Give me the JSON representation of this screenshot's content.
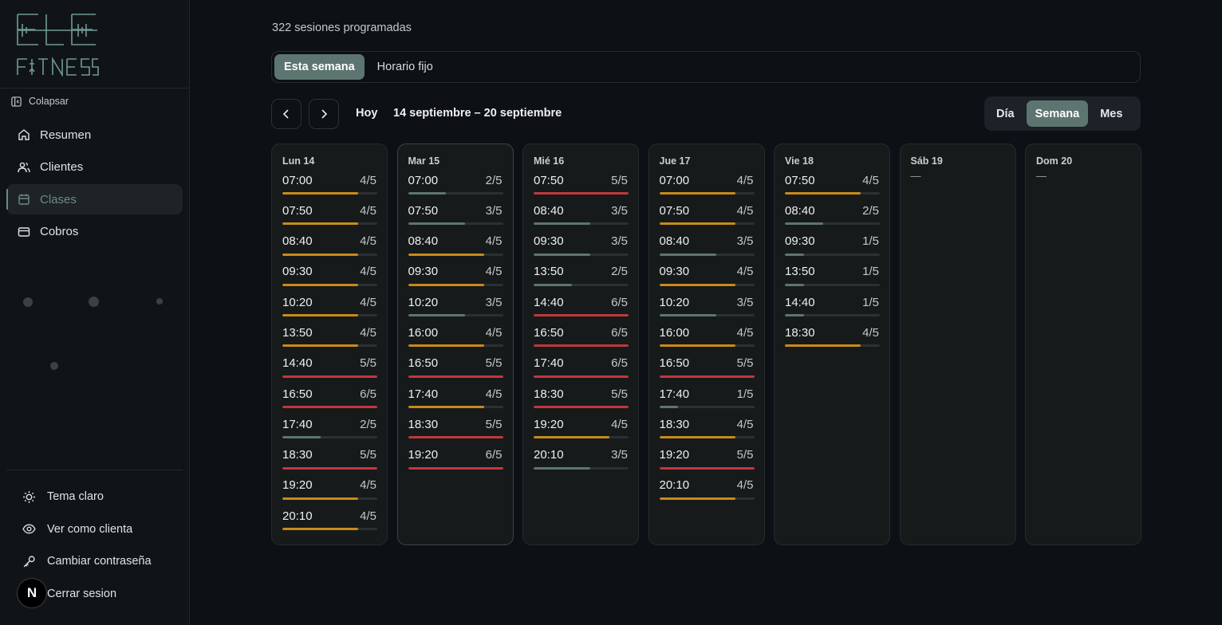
{
  "colors": {
    "orange": "#c98a1b",
    "red": "#c0383d",
    "teal": "#5d7570",
    "track": "#2b3034"
  },
  "sidebar": {
    "brand": "ELE FITNESS",
    "collapse_label": "Colapsar",
    "nav": [
      {
        "label": "Resumen",
        "icon": "home-icon"
      },
      {
        "label": "Clientes",
        "icon": "users-icon"
      },
      {
        "label": "Clases",
        "icon": "calendar-icon",
        "active": true
      },
      {
        "label": "Cobros",
        "icon": "credit-card-icon"
      }
    ],
    "bottom": [
      {
        "label": "Tema claro",
        "icon": "sun-icon"
      },
      {
        "label": "Ver como clienta",
        "icon": "eye-icon"
      },
      {
        "label": "Cambiar contraseña",
        "icon": "key-icon"
      },
      {
        "label": "Cerrar sesion",
        "icon": "logout-icon"
      }
    ],
    "badge": "N"
  },
  "main": {
    "count_text": "322 sesiones programadas",
    "tabs": [
      {
        "label": "Esta semana",
        "active": true
      },
      {
        "label": "Horario fijo",
        "active": false
      }
    ],
    "today_label": "Hoy",
    "range_label": "14 septiembre – 20 septiembre",
    "views": [
      {
        "label": "Día"
      },
      {
        "label": "Semana",
        "active": true
      },
      {
        "label": "Mes"
      }
    ]
  },
  "days": [
    {
      "title": "Lun 14",
      "slots": [
        {
          "time": "07:00",
          "cap": "4/5"
        },
        {
          "time": "07:50",
          "cap": "4/5"
        },
        {
          "time": "08:40",
          "cap": "4/5"
        },
        {
          "time": "09:30",
          "cap": "4/5"
        },
        {
          "time": "10:20",
          "cap": "4/5"
        },
        {
          "time": "13:50",
          "cap": "4/5"
        },
        {
          "time": "14:40",
          "cap": "5/5"
        },
        {
          "time": "16:50",
          "cap": "6/5"
        },
        {
          "time": "17:40",
          "cap": "2/5"
        },
        {
          "time": "18:30",
          "cap": "5/5"
        },
        {
          "time": "19:20",
          "cap": "4/5"
        },
        {
          "time": "20:10",
          "cap": "4/5"
        }
      ]
    },
    {
      "title": "Mar 15",
      "current": true,
      "slots": [
        {
          "time": "07:00",
          "cap": "2/5"
        },
        {
          "time": "07:50",
          "cap": "3/5"
        },
        {
          "time": "08:40",
          "cap": "4/5"
        },
        {
          "time": "09:30",
          "cap": "4/5"
        },
        {
          "time": "10:20",
          "cap": "3/5"
        },
        {
          "time": "16:00",
          "cap": "4/5"
        },
        {
          "time": "16:50",
          "cap": "5/5"
        },
        {
          "time": "17:40",
          "cap": "4/5"
        },
        {
          "time": "18:30",
          "cap": "5/5"
        },
        {
          "time": "19:20",
          "cap": "6/5"
        }
      ]
    },
    {
      "title": "Mié 16",
      "slots": [
        {
          "time": "07:50",
          "cap": "5/5"
        },
        {
          "time": "08:40",
          "cap": "3/5"
        },
        {
          "time": "09:30",
          "cap": "3/5"
        },
        {
          "time": "13:50",
          "cap": "2/5"
        },
        {
          "time": "14:40",
          "cap": "6/5"
        },
        {
          "time": "16:50",
          "cap": "6/5"
        },
        {
          "time": "17:40",
          "cap": "6/5"
        },
        {
          "time": "18:30",
          "cap": "5/5"
        },
        {
          "time": "19:20",
          "cap": "4/5"
        },
        {
          "time": "20:10",
          "cap": "3/5"
        }
      ]
    },
    {
      "title": "Jue 17",
      "slots": [
        {
          "time": "07:00",
          "cap": "4/5"
        },
        {
          "time": "07:50",
          "cap": "4/5"
        },
        {
          "time": "08:40",
          "cap": "3/5"
        },
        {
          "time": "09:30",
          "cap": "4/5"
        },
        {
          "time": "10:20",
          "cap": "3/5"
        },
        {
          "time": "16:00",
          "cap": "4/5"
        },
        {
          "time": "16:50",
          "cap": "5/5"
        },
        {
          "time": "17:40",
          "cap": "1/5"
        },
        {
          "time": "18:30",
          "cap": "4/5"
        },
        {
          "time": "19:20",
          "cap": "5/5"
        },
        {
          "time": "20:10",
          "cap": "4/5"
        }
      ]
    },
    {
      "title": "Vie 18",
      "slots": [
        {
          "time": "07:50",
          "cap": "4/5"
        },
        {
          "time": "08:40",
          "cap": "2/5"
        },
        {
          "time": "09:30",
          "cap": "1/5"
        },
        {
          "time": "13:50",
          "cap": "1/5"
        },
        {
          "time": "14:40",
          "cap": "1/5"
        },
        {
          "time": "18:30",
          "cap": "4/5"
        }
      ]
    },
    {
      "title": "Sáb 19",
      "empty": "—",
      "slots": []
    },
    {
      "title": "Dom 20",
      "empty": "—",
      "slots": []
    }
  ]
}
